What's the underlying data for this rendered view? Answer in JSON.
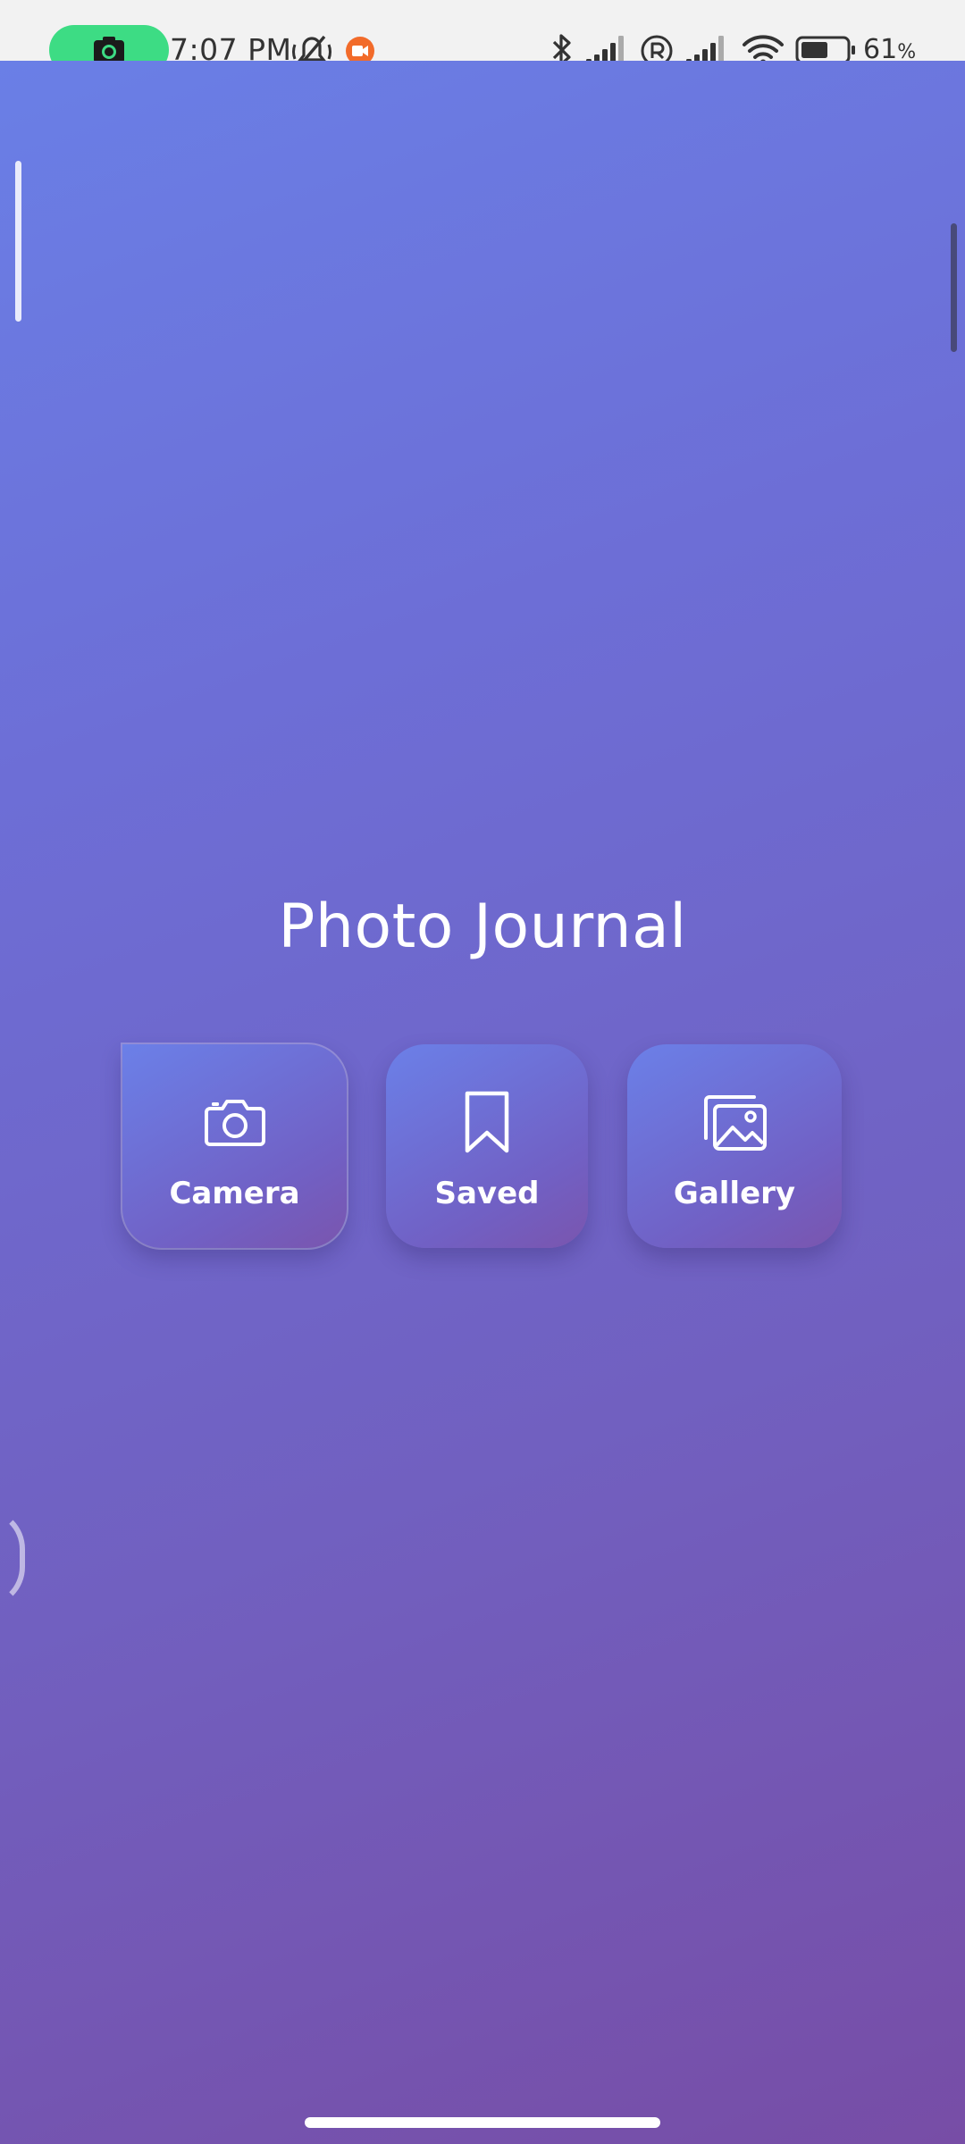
{
  "status_bar": {
    "time": "7:07 PM",
    "battery_percent": "61",
    "battery_percent_sign": "%",
    "battery_level": 0.61,
    "icons": [
      "camera-icon",
      "mute-icon",
      "screen-record-icon",
      "bluetooth-icon",
      "signal-icon",
      "roaming-icon",
      "signal-icon",
      "wifi-icon",
      "battery-icon"
    ],
    "colors": {
      "camera_pill": "#3ddc84",
      "record_dot": "#f26b2a"
    }
  },
  "screen": {
    "title": "Photo Journal",
    "tiles": [
      {
        "label": "Camera",
        "icon": "camera-icon"
      },
      {
        "label": "Saved",
        "icon": "bookmark-icon"
      },
      {
        "label": "Gallery",
        "icon": "gallery-icon"
      }
    ],
    "colors": {
      "gradient_start": "#6a7fe6",
      "gradient_end": "#774da6",
      "text": "#ffffff"
    }
  }
}
